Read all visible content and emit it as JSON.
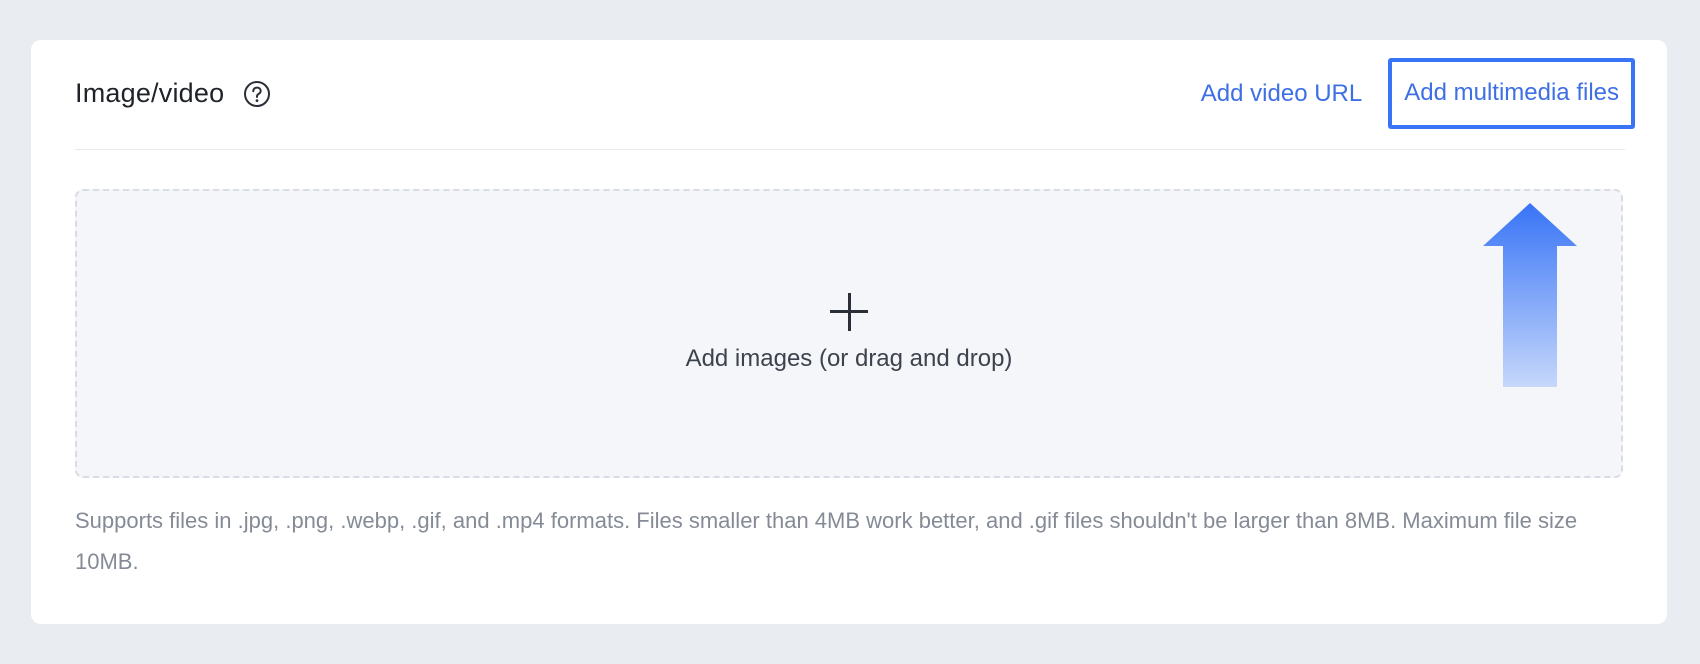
{
  "section": {
    "title": "Image/video",
    "help_icon": "question-circle-icon"
  },
  "actions": {
    "add_video_url": "Add video URL",
    "add_multimedia_files": "Add multimedia files"
  },
  "dropzone": {
    "icon": "plus-icon",
    "label": "Add images (or drag and drop)"
  },
  "help_text": "Supports files in .jpg, .png, .webp, .gif, and .mp4 formats. Files smaller than 4MB work better, and .gif files shouldn't be larger than 8MB. Maximum file size 10MB.",
  "annotation": {
    "arrow_icon": "up-arrow-icon",
    "highlight_color": "#3874f6",
    "link_color": "#3f6fe4"
  }
}
